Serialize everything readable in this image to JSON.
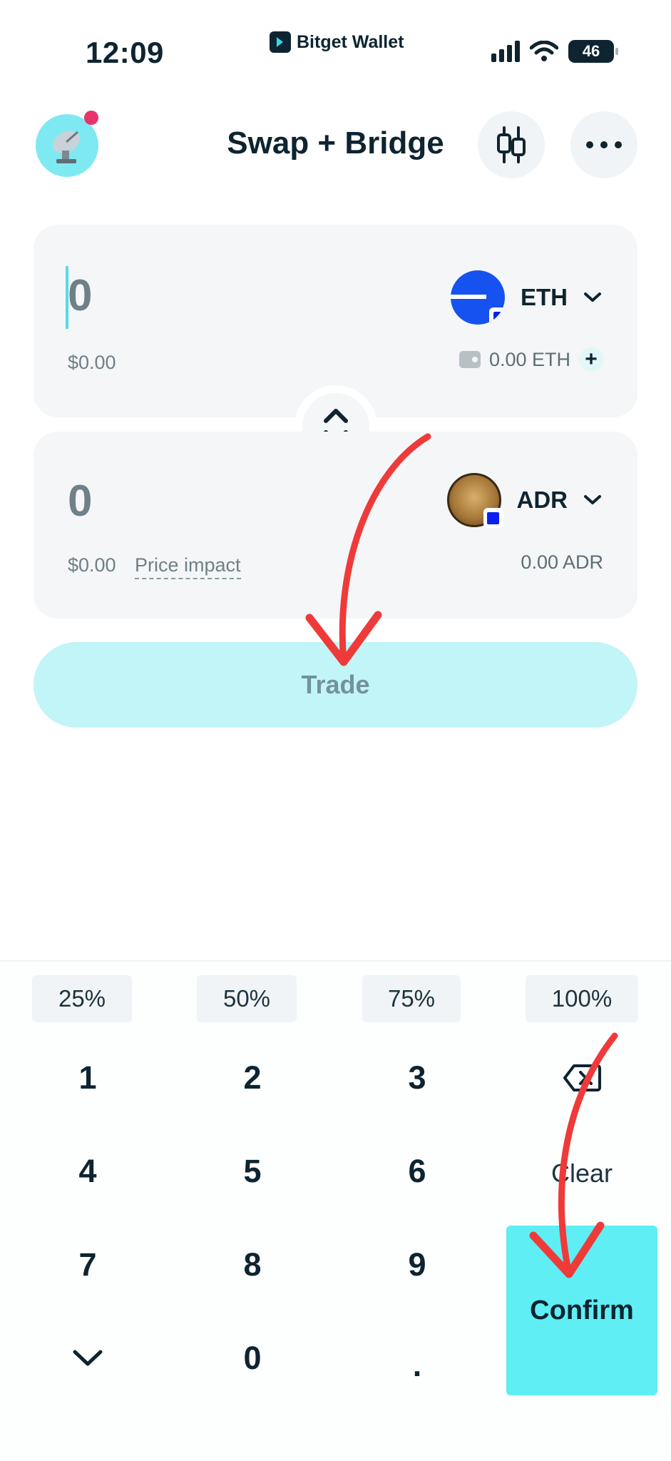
{
  "status_bar": {
    "time": "12:09",
    "app_name": "Bitget Wallet",
    "battery": "46",
    "icons": [
      "signal-icon",
      "wifi-icon",
      "battery-icon"
    ]
  },
  "header": {
    "title": "Swap + Bridge",
    "avatar_icon": "satellite-dish-icon",
    "chart_icon": "candlestick-icon",
    "more_icon": "more-dots-icon",
    "notification_color": "#e8336b"
  },
  "from_card": {
    "amount": "0",
    "usd_value": "$0.00",
    "token": "ETH",
    "balance": "0.00 ETH",
    "add_label": "+"
  },
  "to_card": {
    "amount": "0",
    "usd_value": "$0.00",
    "price_impact_label": "Price impact",
    "token": "ADR",
    "balance": "0.00 ADR"
  },
  "trade_button": {
    "label": "Trade"
  },
  "percent_buttons": [
    "25%",
    "50%",
    "75%",
    "100%"
  ],
  "keypad": {
    "keys": [
      "1",
      "2",
      "3",
      "4",
      "5",
      "6",
      "7",
      "8",
      "9",
      "0",
      "."
    ],
    "clear_label": "Clear",
    "confirm_label": "Confirm",
    "backspace_icon": "backspace-icon",
    "collapse_icon": "chevron-down-icon"
  },
  "colors": {
    "accent": "#5eeef4",
    "trade_disabled_bg": "#c1f5f7",
    "card_bg": "#f4f6f7",
    "annotation_red": "#ef3a3a",
    "eth_blue": "#1652f0"
  }
}
